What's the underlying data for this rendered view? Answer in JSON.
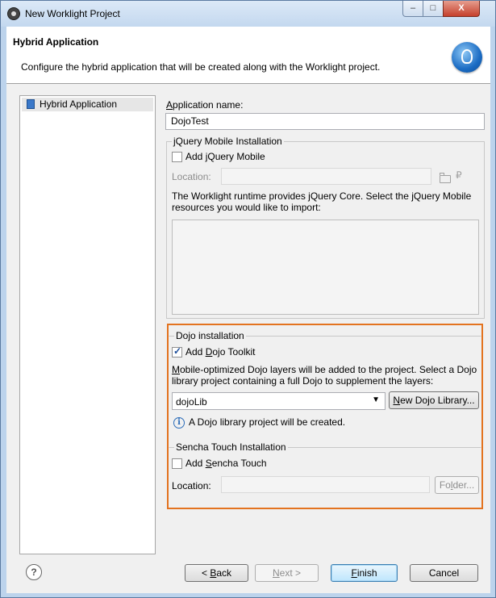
{
  "window": {
    "title": "New Worklight Project",
    "min_glyph": "–",
    "max_glyph": "□",
    "close_glyph": "X"
  },
  "banner": {
    "title": "Hybrid Application",
    "description": "Configure the hybrid application that will be created along with the Worklight project."
  },
  "tree": {
    "items": [
      {
        "label": "Hybrid Application"
      }
    ]
  },
  "app_name": {
    "label_pre": "",
    "label_u": "A",
    "label_post": "pplication name:",
    "value": "DojoTest"
  },
  "jquery": {
    "group_title": "jQuery Mobile Installation",
    "checkbox_pre": "Add ",
    "checkbox_u": "j",
    "checkbox_post": "Query Mobile",
    "checked": false,
    "location_label": "Location:",
    "location_value": "",
    "info_text": "The Worklight runtime provides jQuery Core. Select the jQuery Mobile resources you would like to import:"
  },
  "dojo": {
    "group_title": "Dojo installation",
    "checkbox_pre": "Add ",
    "checkbox_u": "D",
    "checkbox_post": "ojo Toolkit",
    "checked": true,
    "desc_u": "M",
    "desc_rest": "obile-optimized Dojo layers will be added to the project. Select a Dojo library project containing a full Dojo to supplement the layers:",
    "library_value": "dojoLib",
    "new_library_u": "N",
    "new_library_rest": "ew Dojo Library...",
    "info_text": "A Dojo library project will be created."
  },
  "sencha": {
    "group_title": "Sencha Touch Installation",
    "checkbox_pre": "Add ",
    "checkbox_u": "S",
    "checkbox_post": "encha Touch",
    "checked": false,
    "location_label": "Location:",
    "location_value": "",
    "folder_pre": "Fo",
    "folder_u": "l",
    "folder_post": "der..."
  },
  "footer": {
    "help_glyph": "?",
    "back_pre": "< ",
    "back_u": "B",
    "back_post": "ack",
    "next_u": "N",
    "next_post": "ext >",
    "finish_u": "F",
    "finish_post": "inish",
    "cancel_label": "Cancel"
  },
  "colors": {
    "highlight": "#e3731f",
    "title_bar": "#c3d8ef",
    "dialog_bg": "#f0f0f0"
  }
}
